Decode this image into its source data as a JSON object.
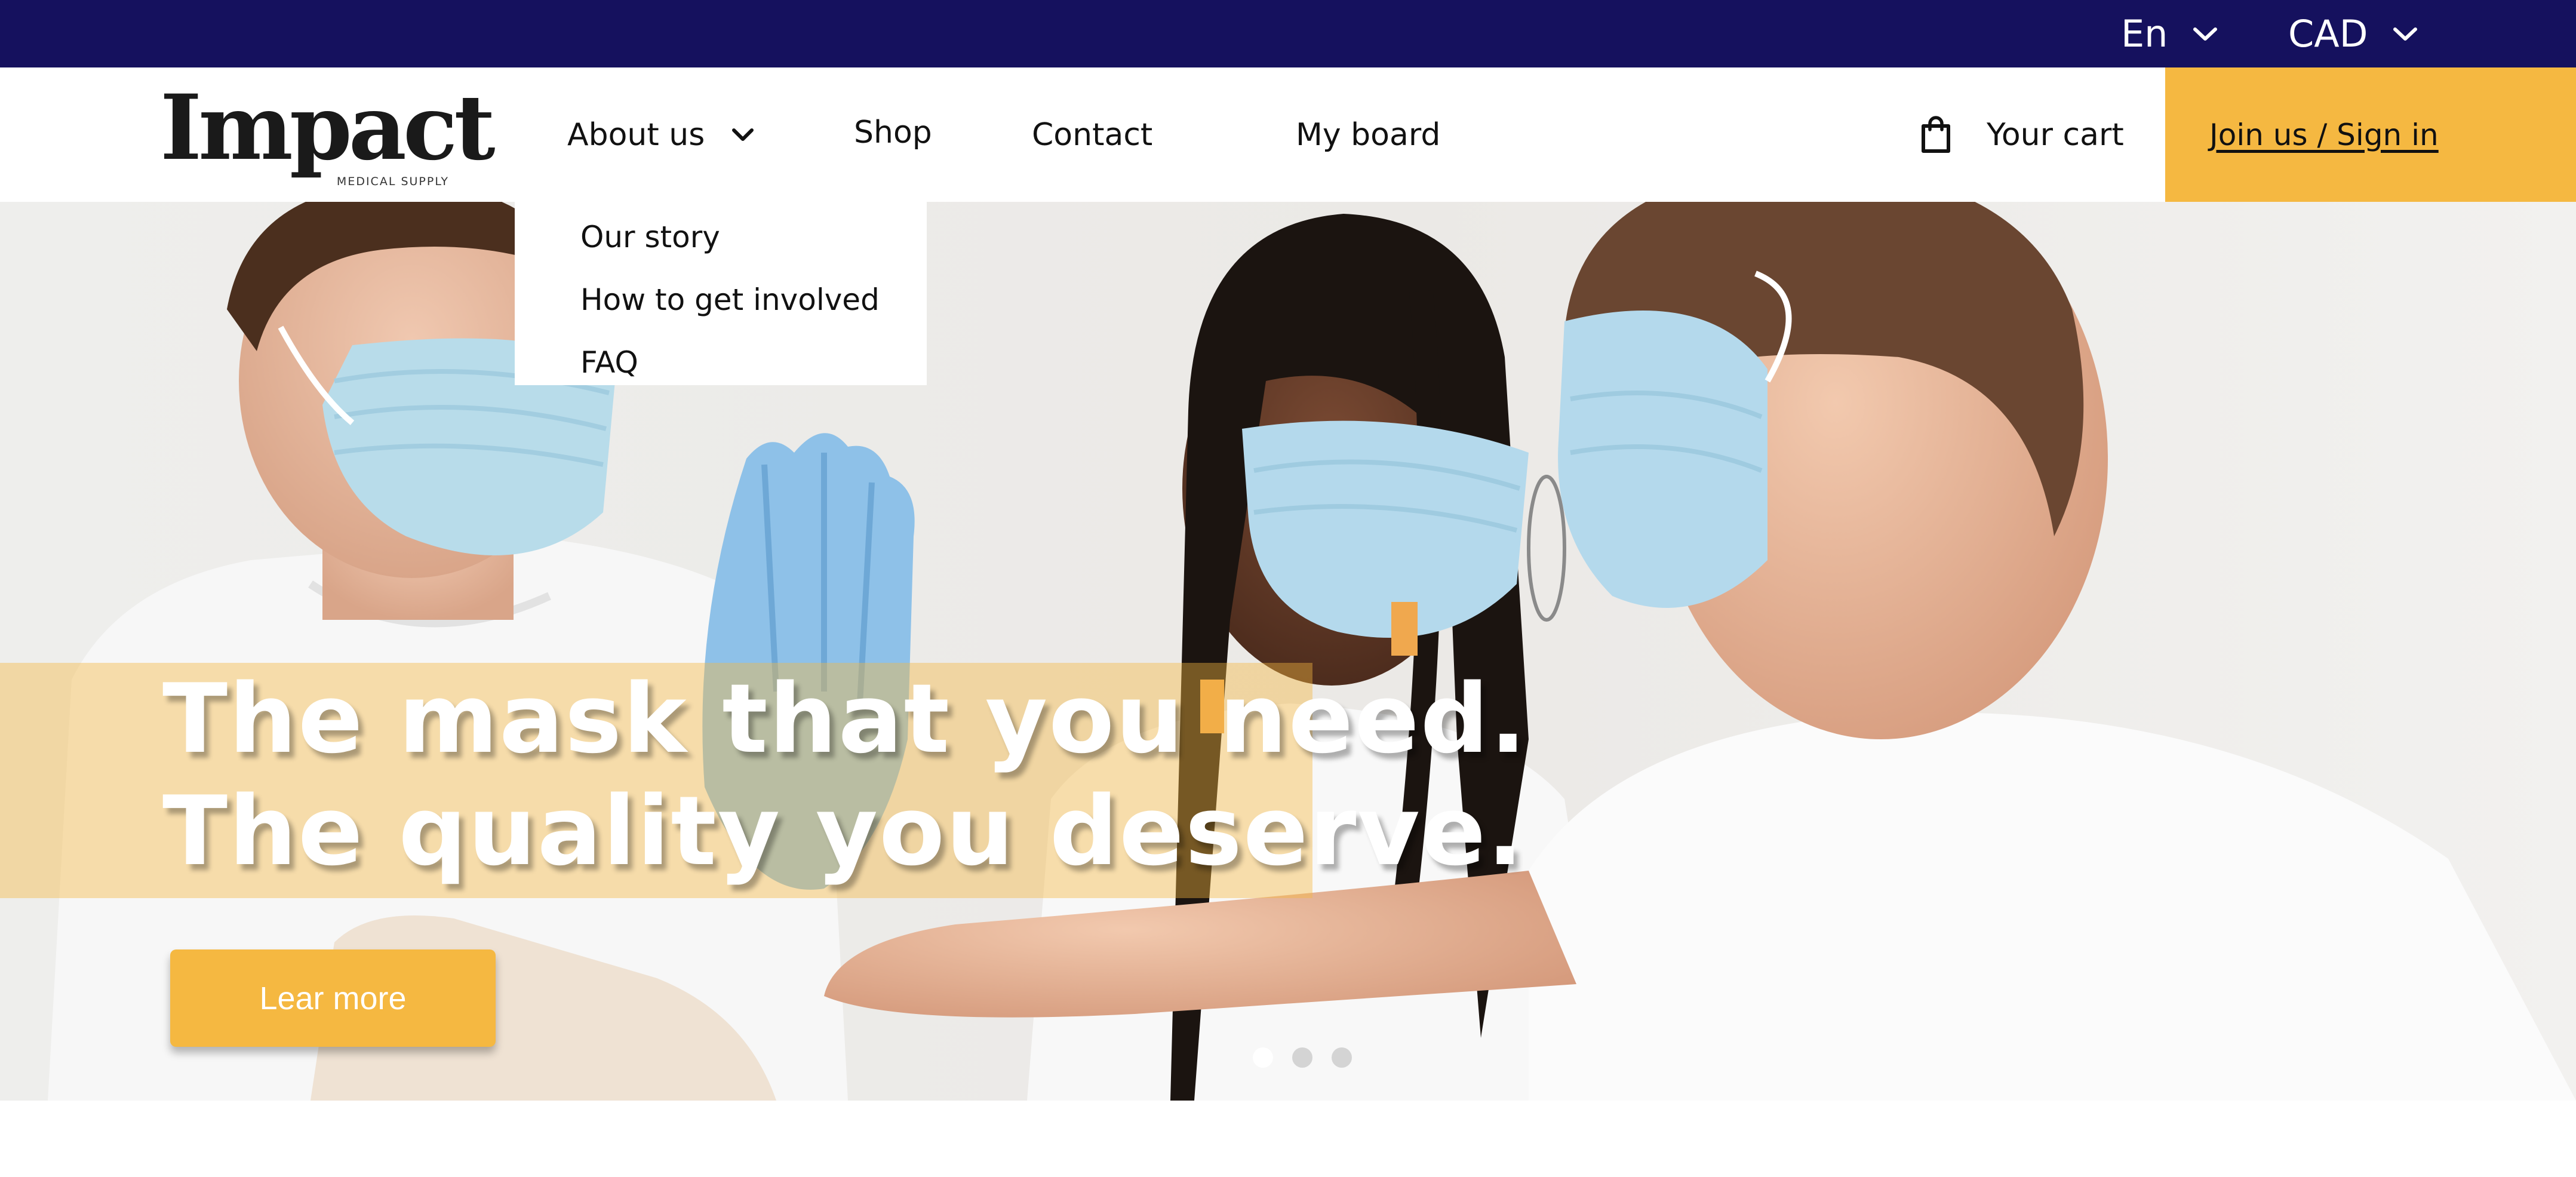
{
  "colors": {
    "topbar": "#15115e",
    "accent": "#f5b841"
  },
  "topbar": {
    "language": {
      "label": "En",
      "icon": "chevron-down-icon"
    },
    "currency": {
      "label": "CAD",
      "icon": "chevron-down-icon"
    }
  },
  "header": {
    "logo": {
      "name": "Impact",
      "tagline": "MEDICAL SUPPLY"
    },
    "nav": {
      "about": "About us",
      "shop": "Shop",
      "contact": "Contact",
      "board": "My board"
    },
    "cart": {
      "label": "Your cart",
      "icon": "shopping-bag-icon"
    },
    "join": "Join us / Sign in"
  },
  "about_dropdown": {
    "items": [
      "Our story",
      "How to get involved",
      "FAQ"
    ]
  },
  "hero": {
    "headline_line1": "The mask that you need.",
    "headline_line2": "The quality you deserve.",
    "cta": "Lear more",
    "slides": {
      "count": 3,
      "active": 1
    }
  }
}
